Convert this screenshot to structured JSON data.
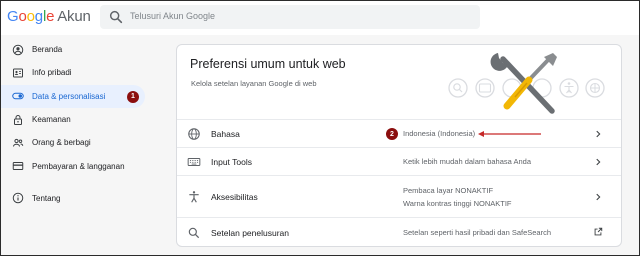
{
  "header": {
    "logo": {
      "g1": "G",
      "g2": "o",
      "g3": "o",
      "g4": "g",
      "g5": "l",
      "g6": "e",
      "product": "Akun"
    },
    "search_placeholder": "Telusuri Akun Google"
  },
  "sidebar": {
    "items": [
      {
        "label": "Beranda",
        "icon": "person-circle-icon",
        "active": false
      },
      {
        "label": "Info pribadi",
        "icon": "id-card-icon",
        "active": false
      },
      {
        "label": "Data & personalisasi",
        "icon": "toggle-icon",
        "active": true
      },
      {
        "label": "Keamanan",
        "icon": "lock-icon",
        "active": false
      },
      {
        "label": "Orang & berbagi",
        "icon": "people-icon",
        "active": false
      },
      {
        "label": "Pembayaran & langganan",
        "icon": "credit-card-icon",
        "active": false
      },
      {
        "label": "Tentang",
        "icon": "info-icon",
        "active": false
      }
    ],
    "marker": "1"
  },
  "card": {
    "title": "Preferensi umum untuk web",
    "subtitle": "Kelola setelan layanan Google di web",
    "rows": [
      {
        "label": "Bahasa",
        "icon": "globe-icon",
        "values": [
          "Indonesia (Indonesia)"
        ],
        "action": "chevron-right-icon",
        "marker": "2"
      },
      {
        "label": "Input Tools",
        "icon": "keyboard-icon",
        "values": [
          "Ketik lebih mudah dalam bahasa Anda"
        ],
        "action": "chevron-right-icon"
      },
      {
        "label": "Aksesibilitas",
        "icon": "accessibility-icon",
        "values": [
          "Pembaca layar NONAKTIF",
          "Warna kontras tinggi NONAKTIF"
        ],
        "action": "chevron-right-icon"
      },
      {
        "label": "Setelan penelusuran",
        "icon": "search-icon",
        "values": [
          "Setelan seperti hasil pribadi dan SafeSearch"
        ],
        "action": "open-external-icon"
      }
    ]
  },
  "colors": {
    "accent": "#1967d2",
    "active_bg": "#e8f0fe",
    "marker": "#8b0e0e",
    "arrow": "#c62828"
  }
}
